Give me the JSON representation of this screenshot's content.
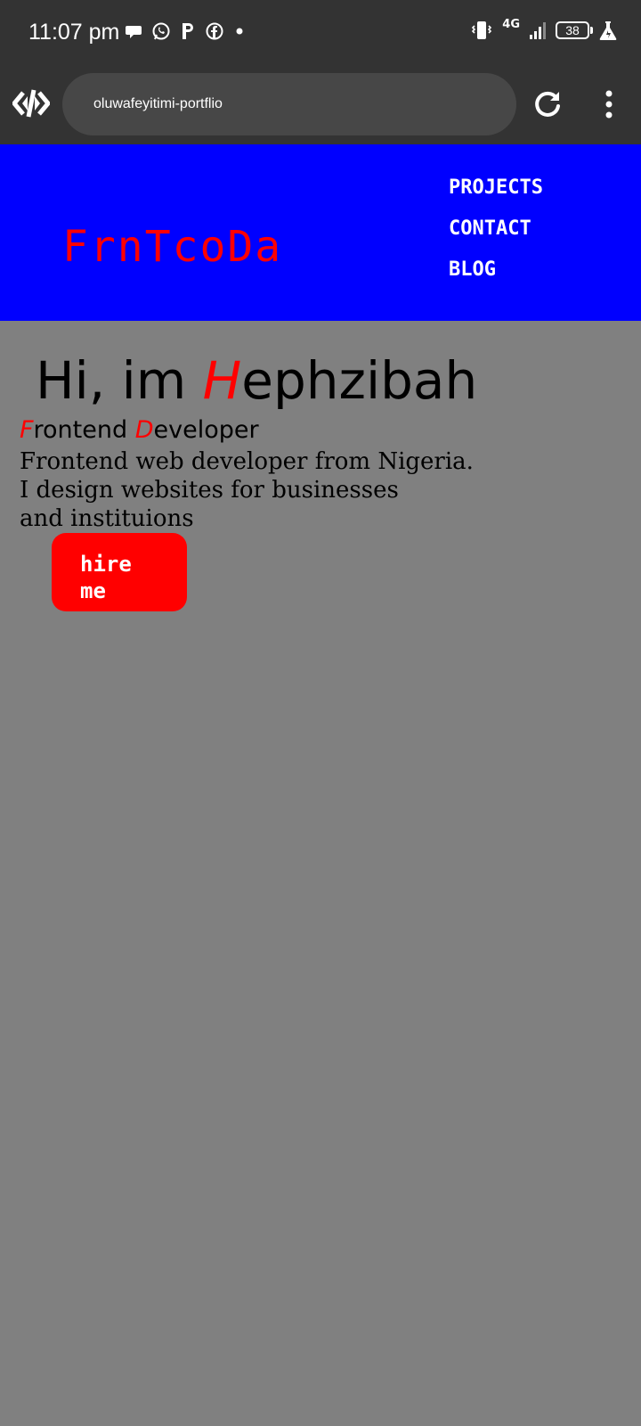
{
  "status_bar": {
    "time": "11:07 pm",
    "network": "4G",
    "battery": "38",
    "left_icons": [
      "chat-bubble-icon",
      "whatsapp-icon",
      "p-app-icon",
      "facebook-icon",
      "dot-icon"
    ],
    "right_icons": [
      "vibrate-icon",
      "signal-icon",
      "battery-icon",
      "flask-icon"
    ]
  },
  "browser": {
    "url": "oluwafeyitimi-portflio",
    "icons": [
      "site-code-icon",
      "reload-icon",
      "menu-dots-icon"
    ]
  },
  "header": {
    "logo": "FrnTcoDa",
    "nav": [
      "PROJECTS",
      "CONTACT",
      "BLOG"
    ]
  },
  "hero": {
    "greeting_prefix": "Hi, im ",
    "name_initial": "H",
    "name_rest": "ephzibah",
    "role_initial_1": "F",
    "role_word_1": "rontend ",
    "role_initial_2": "D",
    "role_word_2": "eveloper",
    "bio_lines": [
      "Frontend web developer from Nigeria.",
      "I design websites for businesses",
      "and instituions"
    ],
    "button_label": "hire\nme"
  },
  "colors": {
    "header_bg": "#0000ff",
    "page_bg": "#808080",
    "accent": "#ff0000",
    "chrome_bg": "#333333"
  }
}
